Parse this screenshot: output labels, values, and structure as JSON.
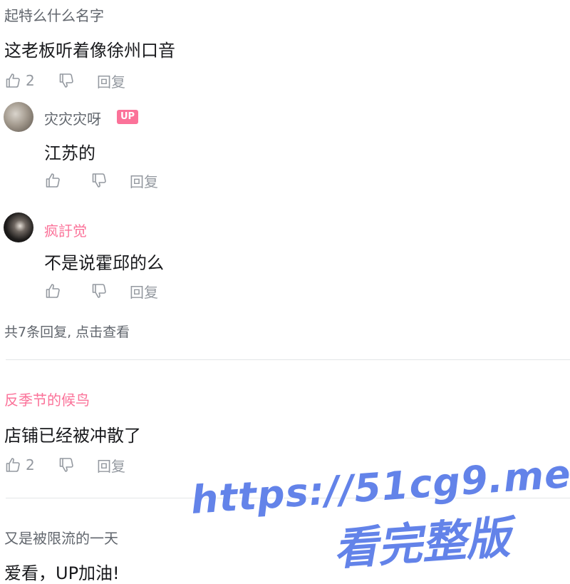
{
  "comments": [
    {
      "user": "起特么什么名字",
      "text": "这老板听着像徐州口音",
      "likes": "2",
      "reply_label": "回复",
      "replies": [
        {
          "user": "灾灾灾呀",
          "badge": "UP",
          "text": "江苏的",
          "likes": "",
          "reply_label": "回复"
        },
        {
          "user": "疯訏觉",
          "text": "不是说霍邱的么",
          "likes": "",
          "reply_label": "回复"
        }
      ],
      "more_replies": "共7条回复, 点击查看"
    },
    {
      "user": "反季节的候鸟",
      "text": "店铺已经被冲散了",
      "likes": "2",
      "reply_label": "回复"
    },
    {
      "user": "又是被限流的一天",
      "text": "爱看，UP加油!"
    }
  ],
  "watermark": {
    "line1": "https://51cg9.me",
    "line2": "看完整版"
  },
  "colors": {
    "pink_username": "#fb7299",
    "gray_text": "#9499a0",
    "watermark": "#5b7de8"
  },
  "icons": [
    "thumb-up-icon",
    "thumb-down-icon"
  ]
}
